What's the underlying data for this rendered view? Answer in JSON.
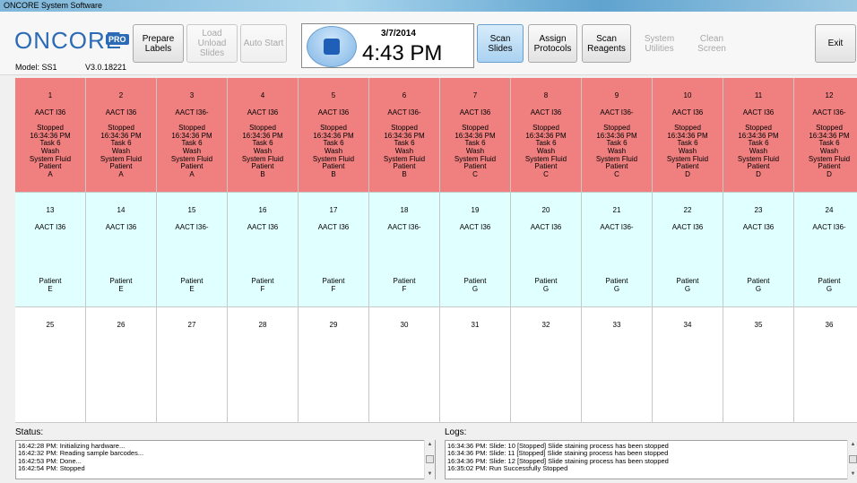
{
  "window": {
    "title": "ONCORE System Software"
  },
  "header": {
    "logo": "ONCORE",
    "logo_badge": "PRO",
    "model": "Model: SS1",
    "version": "V3.0.18221",
    "date": "3/7/2014",
    "time": "4:43 PM"
  },
  "toolbar": {
    "prepare_labels": "Prepare Labels",
    "load_unload": "Load Unload Slides",
    "auto_start": "Auto Start",
    "scan_slides": "Scan Slides",
    "assign_protocols": "Assign Protocols",
    "scan_reagents": "Scan Reagents",
    "system_utilities": "System Utilities",
    "clean_screen": "Clean Screen",
    "exit": "Exit"
  },
  "slides": [
    {
      "num": "1",
      "name": "AACT I36",
      "status": [
        "Stopped",
        "16:34:36 PM",
        "Task 6",
        "Wash",
        "System Fluid"
      ],
      "patient": [
        "Patient",
        "A"
      ]
    },
    {
      "num": "2",
      "name": "AACT I36",
      "status": [
        "Stopped",
        "16:34:36 PM",
        "Task 6",
        "Wash",
        "System Fluid"
      ],
      "patient": [
        "Patient",
        "A"
      ]
    },
    {
      "num": "3",
      "name": "AACT I36-",
      "status": [
        "Stopped",
        "16:34:36 PM",
        "Task 6",
        "Wash",
        "System Fluid"
      ],
      "patient": [
        "Patient",
        "A"
      ]
    },
    {
      "num": "4",
      "name": "AACT I36",
      "status": [
        "Stopped",
        "16:34:36 PM",
        "Task 6",
        "Wash",
        "System Fluid"
      ],
      "patient": [
        "Patient",
        "B"
      ]
    },
    {
      "num": "5",
      "name": "AACT I36",
      "status": [
        "Stopped",
        "16:34:36 PM",
        "Task 6",
        "Wash",
        "System Fluid"
      ],
      "patient": [
        "Patient",
        "B"
      ]
    },
    {
      "num": "6",
      "name": "AACT I36-",
      "status": [
        "Stopped",
        "16:34:36 PM",
        "Task 6",
        "Wash",
        "System Fluid"
      ],
      "patient": [
        "Patient",
        "B"
      ]
    },
    {
      "num": "7",
      "name": "AACT I36",
      "status": [
        "Stopped",
        "16:34:36 PM",
        "Task 6",
        "Wash",
        "System Fluid"
      ],
      "patient": [
        "Patient",
        "C"
      ]
    },
    {
      "num": "8",
      "name": "AACT I36",
      "status": [
        "Stopped",
        "16:34:36 PM",
        "Task 6",
        "Wash",
        "System Fluid"
      ],
      "patient": [
        "Patient",
        "C"
      ]
    },
    {
      "num": "9",
      "name": "AACT I36-",
      "status": [
        "Stopped",
        "16:34:36 PM",
        "Task 6",
        "Wash",
        "System Fluid"
      ],
      "patient": [
        "Patient",
        "C"
      ]
    },
    {
      "num": "10",
      "name": "AACT I36",
      "status": [
        "Stopped",
        "16:34:36 PM",
        "Task 6",
        "Wash",
        "System Fluid"
      ],
      "patient": [
        "Patient",
        "D"
      ]
    },
    {
      "num": "11",
      "name": "AACT I36",
      "status": [
        "Stopped",
        "16:34:36 PM",
        "Task 6",
        "Wash",
        "System Fluid"
      ],
      "patient": [
        "Patient",
        "D"
      ]
    },
    {
      "num": "12",
      "name": "AACT I36-",
      "status": [
        "Stopped",
        "16:34:36 PM",
        "Task 6",
        "Wash",
        "System Fluid"
      ],
      "patient": [
        "Patient",
        "D"
      ]
    },
    {
      "num": "13",
      "name": "AACT I36",
      "status": [],
      "patient": [
        "Patient",
        "E"
      ]
    },
    {
      "num": "14",
      "name": "AACT I36",
      "status": [],
      "patient": [
        "Patient",
        "E"
      ]
    },
    {
      "num": "15",
      "name": "AACT I36-",
      "status": [],
      "patient": [
        "Patient",
        "E"
      ]
    },
    {
      "num": "16",
      "name": "AACT I36",
      "status": [],
      "patient": [
        "Patient",
        "F"
      ]
    },
    {
      "num": "17",
      "name": "AACT I36",
      "status": [],
      "patient": [
        "Patient",
        "F"
      ]
    },
    {
      "num": "18",
      "name": "AACT I36-",
      "status": [],
      "patient": [
        "Patient",
        "F"
      ]
    },
    {
      "num": "19",
      "name": "AACT I36",
      "status": [],
      "patient": [
        "Patient",
        "G"
      ]
    },
    {
      "num": "20",
      "name": "AACT I36",
      "status": [],
      "patient": [
        "Patient",
        "G"
      ]
    },
    {
      "num": "21",
      "name": "AACT I36-",
      "status": [],
      "patient": [
        "Patient",
        "G"
      ]
    },
    {
      "num": "22",
      "name": "AACT I36",
      "status": [],
      "patient": [
        "Patient",
        "G"
      ]
    },
    {
      "num": "23",
      "name": "AACT I36",
      "status": [],
      "patient": [
        "Patient",
        "G"
      ]
    },
    {
      "num": "24",
      "name": "AACT I36-",
      "status": [],
      "patient": [
        "Patient",
        "G"
      ]
    },
    {
      "num": "25",
      "name": "",
      "status": [],
      "patient": []
    },
    {
      "num": "26",
      "name": "",
      "status": [],
      "patient": []
    },
    {
      "num": "27",
      "name": "",
      "status": [],
      "patient": []
    },
    {
      "num": "28",
      "name": "",
      "status": [],
      "patient": []
    },
    {
      "num": "29",
      "name": "",
      "status": [],
      "patient": []
    },
    {
      "num": "30",
      "name": "",
      "status": [],
      "patient": []
    },
    {
      "num": "31",
      "name": "",
      "status": [],
      "patient": []
    },
    {
      "num": "32",
      "name": "",
      "status": [],
      "patient": []
    },
    {
      "num": "33",
      "name": "",
      "status": [],
      "patient": []
    },
    {
      "num": "34",
      "name": "",
      "status": [],
      "patient": []
    },
    {
      "num": "35",
      "name": "",
      "status": [],
      "patient": []
    },
    {
      "num": "36",
      "name": "",
      "status": [],
      "patient": []
    }
  ],
  "status_panel": {
    "label": "Status:",
    "lines": [
      "16:42:28 PM: Initializing hardware...",
      "16:42:32 PM: Reading sample barcodes...",
      "16:42:53 PM: Done...",
      "16:42:54 PM: Stopped"
    ]
  },
  "logs_panel": {
    "label": "Logs:",
    "lines": [
      "16:34:36 PM: Slide: 10 [Stopped] Slide staining process has been stopped",
      "16:34:36 PM: Slide: 11 [Stopped] Slide staining process has been stopped",
      "16:34:36 PM: Slide: 12 [Stopped] Slide staining process has been stopped",
      "16:35:02 PM: Run Successfully Stopped"
    ]
  },
  "colors": {
    "stopped_row": "#f08080",
    "assigned_row": "#e0ffff",
    "empty_row": "#ffffff",
    "accent": "#2b6bb5"
  }
}
